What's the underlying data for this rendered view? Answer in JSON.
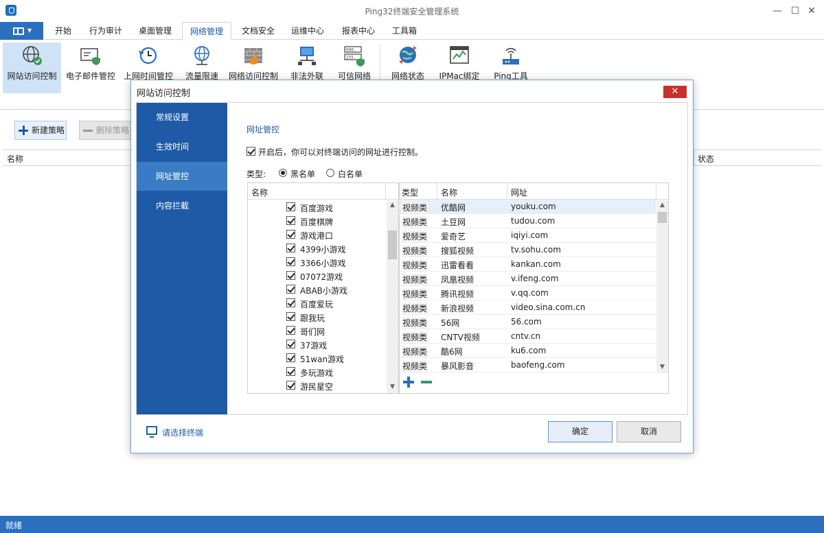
{
  "window": {
    "title": "Ping32终端安全管理系统"
  },
  "menu": {
    "tabs": [
      "开始",
      "行为审计",
      "桌面管理",
      "网络管理",
      "文档安全",
      "运维中心",
      "报表中心",
      "工具箱"
    ],
    "active_index": 3
  },
  "ribbon": {
    "buttons": [
      "网站访问控制",
      "电子邮件管控",
      "上网时间管控",
      "流量限速",
      "网络访问控制",
      "非法外联",
      "可信网络",
      "网络状态",
      "IPMac绑定",
      "Ping工具"
    ]
  },
  "toolbar": {
    "new_policy": "新建策略",
    "delete_policy": "删除策略"
  },
  "grid": {
    "col_name": "名称",
    "col_status": "状态"
  },
  "status": {
    "text": "就绪"
  },
  "dialog": {
    "title": "网站访问控制",
    "close": "✕",
    "nav": [
      "常规设置",
      "生效时间",
      "网址管控",
      "内容拦截"
    ],
    "active_nav": 2,
    "section_title": "网址管控",
    "enable_text": "开启后，你可以对终端访问的网址进行控制。",
    "type_label": "类型:",
    "blacklist": "黑名单",
    "whitelist": "白名单",
    "tree_header": "名称",
    "tree_items": [
      "百度游戏",
      "百度棋牌",
      "游戏港口",
      "4399小游戏",
      "3366小游戏",
      "07072游戏",
      "ABAB小游戏",
      "百度爱玩",
      "跟我玩",
      "哥们网",
      "37游戏",
      "51wan游戏",
      "多玩游戏",
      "游民星空"
    ],
    "url_headers": {
      "type": "类型",
      "name": "名称",
      "url": "网址"
    },
    "url_rows": [
      {
        "type": "视频类",
        "name": "优酷网",
        "url": "youku.com"
      },
      {
        "type": "视频类",
        "name": "土豆网",
        "url": "tudou.com"
      },
      {
        "type": "视频类",
        "name": "爱奇艺",
        "url": "iqiyi.com"
      },
      {
        "type": "视频类",
        "name": "搜狐视频",
        "url": "tv.sohu.com"
      },
      {
        "type": "视频类",
        "name": "迅雷看看",
        "url": "kankan.com"
      },
      {
        "type": "视频类",
        "name": "凤凰视频",
        "url": "v.ifeng.com"
      },
      {
        "type": "视频类",
        "name": "腾讯视频",
        "url": "v.qq.com"
      },
      {
        "type": "视频类",
        "name": "新浪视频",
        "url": "video.sina.com.cn"
      },
      {
        "type": "视频类",
        "name": "56网",
        "url": "56.com"
      },
      {
        "type": "视频类",
        "name": "CNTV视频",
        "url": "cntv.cn"
      },
      {
        "type": "视频类",
        "name": "酷6网",
        "url": "ku6.com"
      },
      {
        "type": "视频类",
        "name": "暴风影音",
        "url": "baofeng.com"
      }
    ],
    "select_terminal": "请选择终端",
    "ok": "确定",
    "cancel": "取消"
  }
}
